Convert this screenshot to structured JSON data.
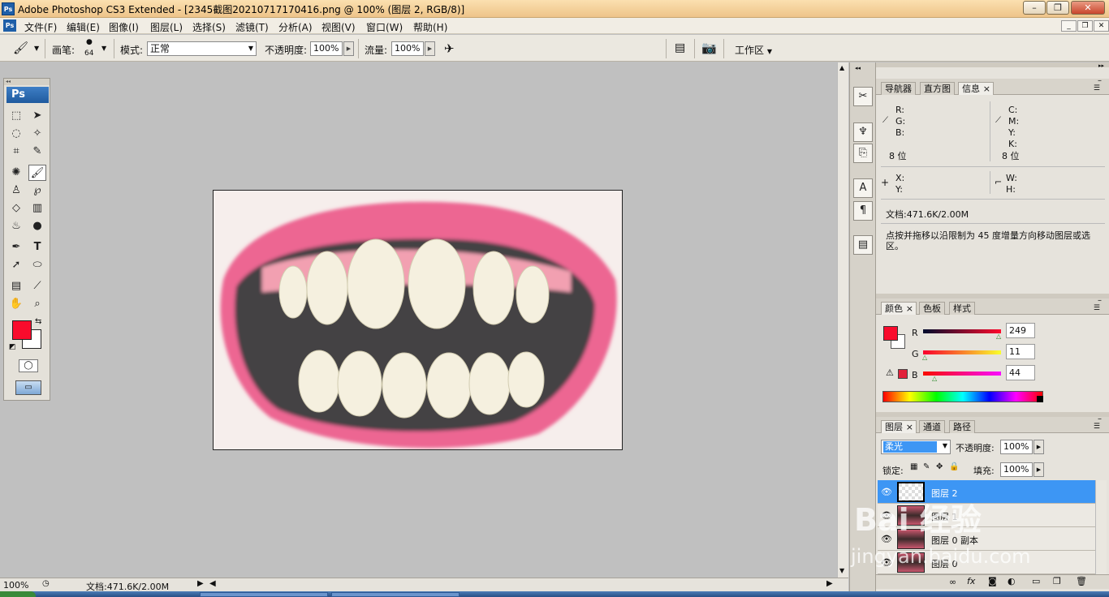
{
  "window": {
    "title": "Adobe Photoshop CS3 Extended - [2345截图20210717170416.png @ 100% (图层 2, RGB/8)]",
    "app_icon": "Ps"
  },
  "menu": [
    "文件(F)",
    "编辑(E)",
    "图像(I)",
    "图层(L)",
    "选择(S)",
    "滤镜(T)",
    "分析(A)",
    "视图(V)",
    "窗口(W)",
    "帮助(H)"
  ],
  "options": {
    "brush_label": "画笔:",
    "brush_size": "64",
    "mode_label": "模式:",
    "mode_value": "正常",
    "opacity_label": "不透明度:",
    "opacity_value": "100%",
    "flow_label": "流量:",
    "flow_value": "100%",
    "workspace_label": "工作区"
  },
  "toolbox": {
    "logo": "Ps",
    "foreground": "#f90b2c",
    "background": "#ffffff"
  },
  "status": {
    "zoom": "100%",
    "doc": "文档:471.6K/2.00M"
  },
  "info_panel": {
    "tabs": [
      "导航器",
      "直方图",
      "信息"
    ],
    "active_tab": "信息",
    "rgb_labels": [
      "R:",
      "G:",
      "B:"
    ],
    "cmyk_labels": [
      "C:",
      "M:",
      "Y:",
      "K:"
    ],
    "bits_left": "8 位",
    "bits_right": "8 位",
    "xy_labels": [
      "X:",
      "Y:"
    ],
    "wh_labels": [
      "W:",
      "H:"
    ],
    "doc": "文档:471.6K/2.00M",
    "hint": "点按并拖移以沿限制为 45 度增量方向移动图层或选区。"
  },
  "color_panel": {
    "tabs": [
      "颜色",
      "色板",
      "样式"
    ],
    "channels": [
      {
        "name": "R",
        "value": "249"
      },
      {
        "name": "G",
        "value": "11"
      },
      {
        "name": "B",
        "value": "44"
      }
    ],
    "swatch": "#f90b2c"
  },
  "layers_panel": {
    "tabs": [
      "图层",
      "通道",
      "路径"
    ],
    "blend_mode": "柔光",
    "opacity_label": "不透明度:",
    "opacity_value": "100%",
    "lock_label": "锁定:",
    "fill_label": "填充:",
    "fill_value": "100%",
    "layers": [
      {
        "name": "图层 2",
        "selected": true
      },
      {
        "name": "图层 1",
        "selected": false
      },
      {
        "name": "图层 0 副本",
        "selected": false
      },
      {
        "name": "图层 0",
        "selected": false
      }
    ]
  },
  "watermark": {
    "brand": "Bai 经验",
    "url": "jingyan.baidu.com"
  }
}
